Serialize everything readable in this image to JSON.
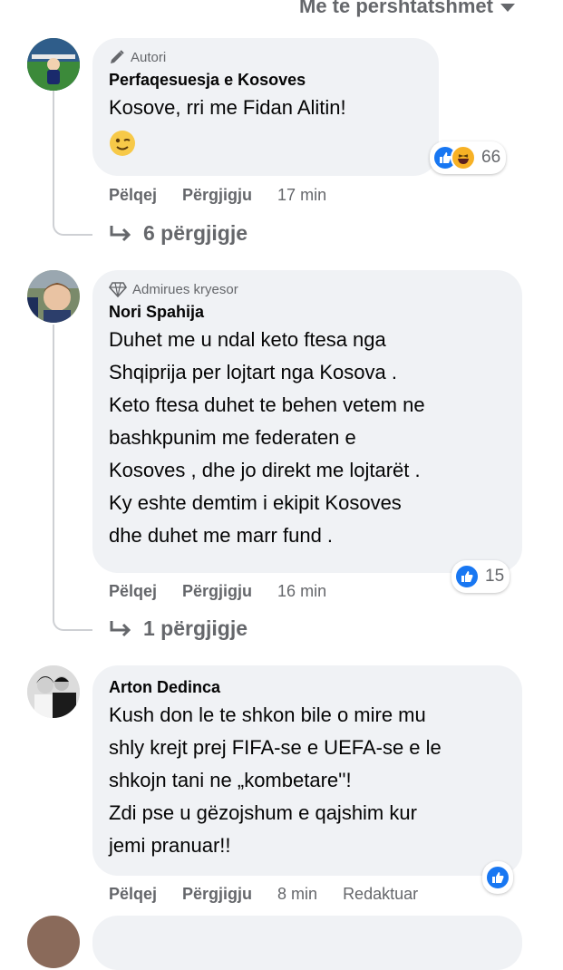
{
  "sort_label": "Me te pershtatshmet",
  "comments": [
    {
      "badge": "Autori",
      "badge_icon": "pencil-icon",
      "author": "Perfaqesuesja e Kosoves",
      "lines": [
        "Kosove, rri me Fidan Alitin!"
      ],
      "emoji": "winking-face-emoji",
      "reaction_count": "66",
      "reactions": [
        "like",
        "haha"
      ],
      "like_label": "Pëlqej",
      "reply_label": "Përgjigju",
      "time": "17 min",
      "replies_label": "6 përgjigje"
    },
    {
      "badge": "Admirues kryesor",
      "badge_icon": "diamond-icon",
      "author": "Nori Spahija",
      "lines": [
        "Duhet me u ndal keto ftesa nga",
        "Shqiprija per lojtart nga Kosova .",
        "Keto ftesa duhet te behen vetem ne",
        "bashkpunim me federaten e",
        "Kosoves , dhe jo direkt me lojtarët .",
        "Ky eshte demtim i ekipit Kosoves",
        "dhe duhet me marr fund ."
      ],
      "reaction_count": "15",
      "reactions": [
        "like"
      ],
      "like_label": "Pëlqej",
      "reply_label": "Përgjigju",
      "time": "16 min",
      "replies_label": "1 përgjigje"
    },
    {
      "author": "Arton Dedinca",
      "lines": [
        "Kush don le te shkon bile o mire mu",
        "shly krejt prej FIFA-se e UEFA-se e le",
        "shkojn tani ne „kombetare''!",
        "Zdi pse u gëzojshum e qajshim kur",
        "jemi pranuar!!"
      ],
      "reactions": [
        "like"
      ],
      "like_label": "Pëlqej",
      "reply_label": "Përgjigju",
      "time": "8 min",
      "edited_label": "Redaktuar"
    }
  ],
  "colors": {
    "like_blue": "#1877f2",
    "bubble": "#f0f2f5",
    "muted": "#65676b"
  }
}
